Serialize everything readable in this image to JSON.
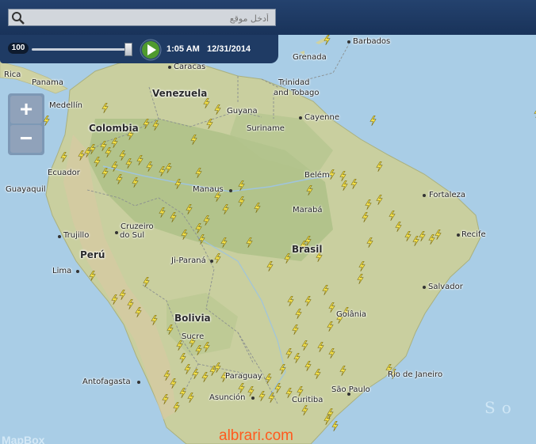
{
  "search": {
    "placeholder": "أدخل موقع"
  },
  "player": {
    "speed": "100",
    "time": "1:05 AM",
    "date": "12/31/2014",
    "progress": 0.97
  },
  "zoom": {
    "in_label": "+",
    "out_label": "−"
  },
  "labels": {
    "cities": [
      "Barbados",
      "Grenada",
      "Caracas",
      "Trinidad",
      "and Tobago",
      "Panama",
      "Rica",
      "Medellín",
      "Guyana",
      "Suriname",
      "Cayenne",
      "Ecuador",
      "Guayaquil",
      "Manaus",
      "Belém",
      "Fortaleza",
      "Marabá",
      "Trujillo",
      "Cruzeiro",
      "do Sul",
      "Recife",
      "Ji-Paraná",
      "Lima",
      "Salvador",
      "Goiânia",
      "Sucre",
      "Rio de Janeiro",
      "Antofagasta",
      "Paraguay",
      "Asunción",
      "São Paulo",
      "Curitiba"
    ],
    "countries": [
      "Venezuela",
      "Colombia",
      "Perú",
      "Brasil",
      "Bolivia"
    ],
    "ocean": "So",
    "attribution": "MapBox"
  },
  "watermark": "albrari.com",
  "colors": {
    "land": "#c9cf9f",
    "forest": "#aabf84",
    "ocean": "#a9cde6",
    "bar": "#1f3b64",
    "lightning": "#f2e04a",
    "watermark": "#ff5a1e"
  },
  "icons": {
    "search": "magnifier-icon",
    "play": "play-icon",
    "lightning": "lightning-bolt-icon"
  }
}
